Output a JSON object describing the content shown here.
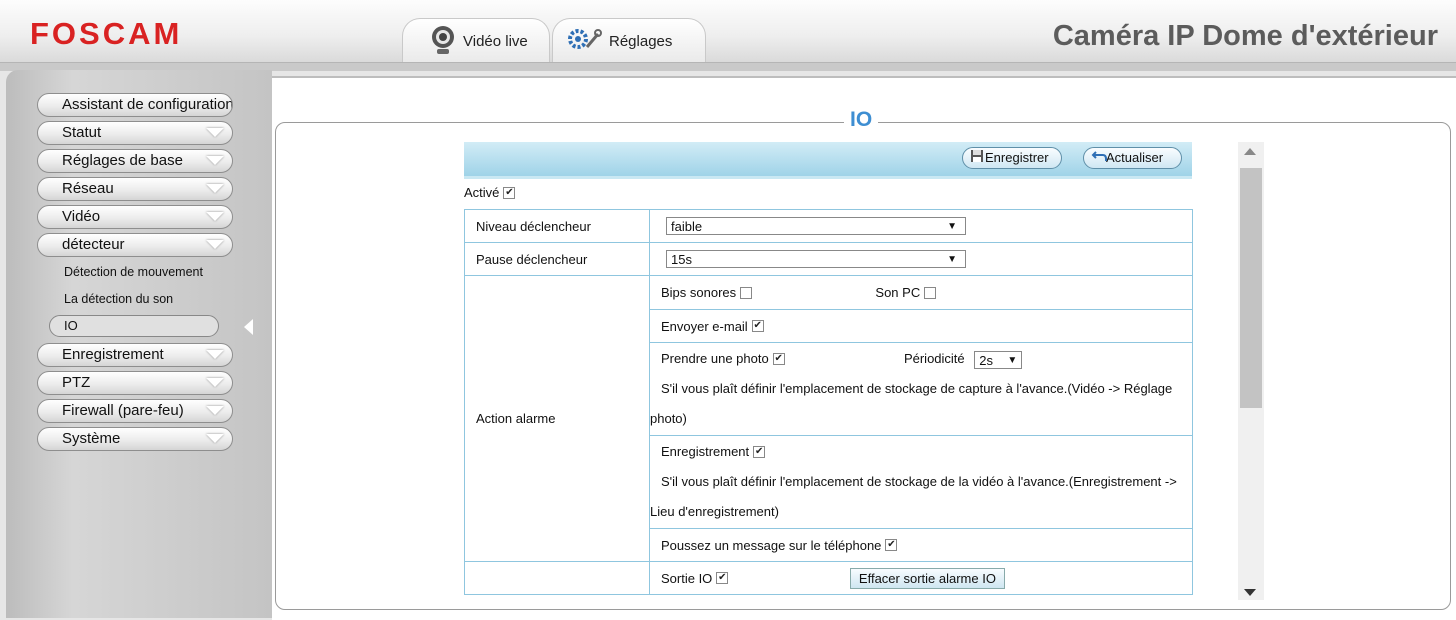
{
  "header": {
    "logo": "FOSCAM",
    "device_title": "Caméra IP Dome d'extérieur",
    "tabs": [
      {
        "label": "Vidéo live",
        "icon": "webcam-icon"
      },
      {
        "label": "Réglages",
        "icon": "gears-icon"
      }
    ]
  },
  "sidebar": {
    "items": [
      {
        "label": "Assistant de configuration"
      },
      {
        "label": "Statut"
      },
      {
        "label": "Réglages de base"
      },
      {
        "label": "Réseau"
      },
      {
        "label": "Vidéo"
      },
      {
        "label": "détecteur"
      },
      {
        "label": "Enregistrement"
      },
      {
        "label": "PTZ"
      },
      {
        "label": "Firewall (pare-feu)"
      },
      {
        "label": "Système"
      }
    ],
    "sub_items": [
      "Détection de mouvement",
      "La détection du son",
      "IO"
    ],
    "active_sub_item": "IO"
  },
  "main": {
    "section_title": "IO",
    "toolbar": {
      "save_label": "Enregistrer",
      "refresh_label": "Actualiser"
    },
    "enabled_label": "Activé",
    "enabled": true,
    "form": {
      "trigger_level_label": "Niveau déclencheur",
      "trigger_level_value": "faible",
      "trigger_pause_label": "Pause déclencheur",
      "trigger_pause_value": "15s",
      "alarm_action_label": "Action alarme",
      "beeps_label": "Bips sonores",
      "beeps_checked": false,
      "pc_sound_label": "Son PC",
      "pc_sound_checked": false,
      "email_label": "Envoyer e-mail",
      "email_checked": true,
      "snapshot_label": "Prendre une photo",
      "snapshot_checked": true,
      "interval_label": "Périodicité",
      "interval_value": "2s",
      "snapshot_note": "S'il vous plaît définir l'emplacement de stockage de capture à l'avance.(Vidéo -> Réglage photo)",
      "record_label": "Enregistrement",
      "record_checked": true,
      "record_note": "S'il vous plaît définir l'emplacement de stockage de la vidéo à l'avance.(Enregistrement -> Lieu d'enregistrement)",
      "push_label": "Poussez un message sur le téléphone",
      "push_checked": true,
      "io_output_label": "Sortie IO",
      "io_output_checked": true,
      "clear_io_label": "Effacer sortie alarme IO"
    }
  },
  "colors": {
    "logo_red": "#d92222",
    "accent_blue": "#3e8ed2",
    "toolbar_blue": "#9fd3e8",
    "table_border": "#8fc6df"
  }
}
